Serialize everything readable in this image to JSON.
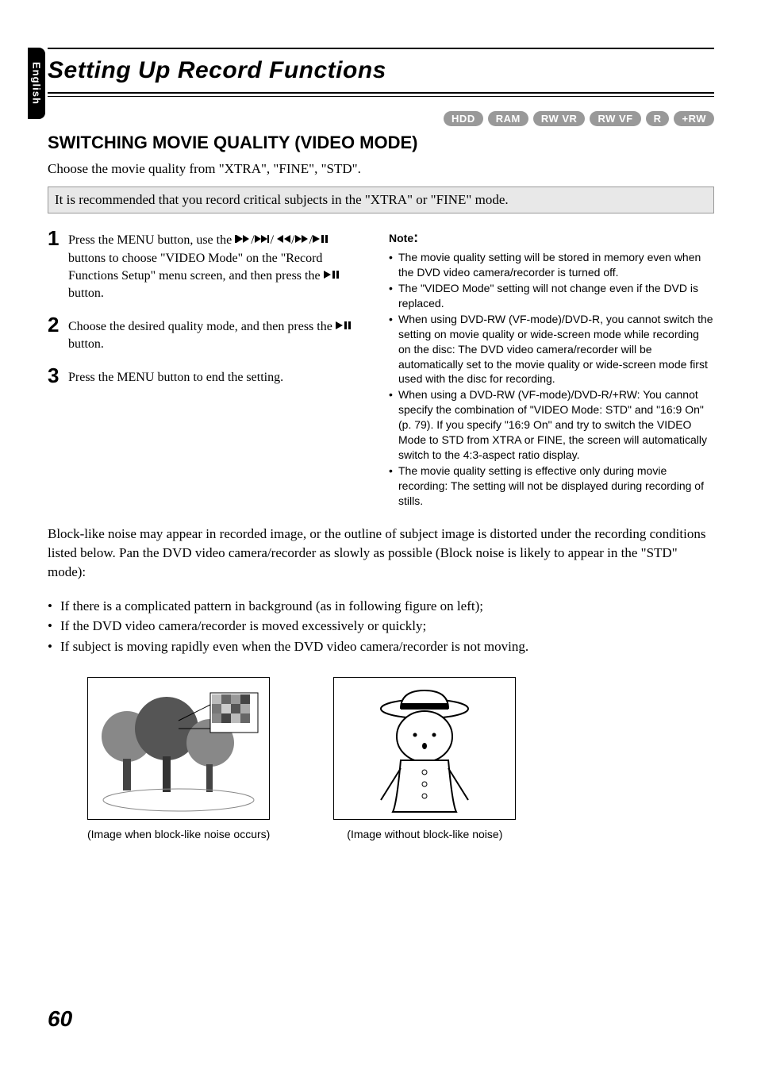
{
  "side_tab": "English",
  "main_title": "Setting Up Record Functions",
  "badges": [
    "HDD",
    "RAM",
    "RW VR",
    "RW VF",
    "R",
    "+RW"
  ],
  "section_title": "SWITCHING MOVIE QUALITY (VIDEO MODE)",
  "intro_text": "Choose the movie quality from \"XTRA\", \"FINE\", \"STD\".",
  "highlight_text": "It is recommended that you record critical subjects in the \"XTRA\" or \"FINE\" mode.",
  "steps": [
    {
      "num": "1",
      "parts": [
        "Press the MENU button, use the ",
        " buttons to choose \"VIDEO Mode\" on the \"Record Functions Setup\" menu screen, and then press the ",
        " button."
      ]
    },
    {
      "num": "2",
      "parts": [
        "Choose the desired quality mode, and then press the ",
        " button."
      ]
    },
    {
      "num": "3",
      "parts": [
        "Press the MENU button to end the setting."
      ]
    }
  ],
  "note_label": "Note",
  "notes": [
    "The movie quality setting will be stored in memory even when the DVD video camera/recorder is turned off.",
    "The \"VIDEO Mode\" setting will not change even if the DVD is replaced.",
    "When using DVD-RW (VF-mode)/DVD-R, you cannot switch the setting on movie quality or wide-screen mode while recording on the disc: The DVD video camera/recorder will be automatically set to the movie quality or wide-screen mode first used with the disc for recording.",
    "When using a DVD-RW (VF-mode)/DVD-R/+RW: You cannot specify the combination of \"VIDEO Mode: STD\" and \"16:9 On\"(p. 79). If you specify \"16:9 On\" and try to switch the VIDEO Mode to STD from XTRA or FINE, the screen will automatically switch to the 4:3-aspect ratio display.",
    "The movie quality setting is effective only during movie recording: The setting will not be displayed during recording of stills."
  ],
  "block_noise_para": "Block-like noise may appear in recorded image, or the outline of subject image is distorted under the recording conditions listed below. Pan the DVD video camera/recorder as slowly as possible (Block noise is likely to appear in the \"STD\" mode):",
  "bullets": [
    "If there is a complicated pattern in background (as in following figure on left);",
    "If the DVD video camera/recorder is moved excessively or quickly;",
    "If subject is moving rapidly even when the DVD video camera/recorder is not moving."
  ],
  "figure_captions": [
    "(Image when block-like noise occurs)",
    "(Image without block-like noise)"
  ],
  "page_number": "60"
}
